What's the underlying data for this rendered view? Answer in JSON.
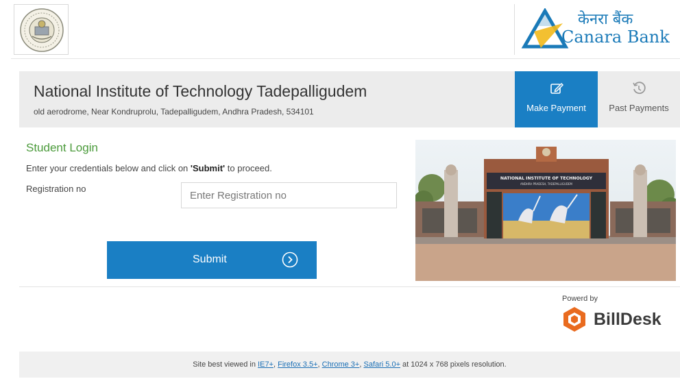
{
  "header": {
    "institute_logo_icon": "institute-seal-icon",
    "bank_name_hindi": "केनरा बैंक",
    "bank_name": "Canara Bank",
    "bank_colors": {
      "blue": "#1a7ab8",
      "yellow": "#f2b91b"
    }
  },
  "title_bar": {
    "institute_name": "National Institute of Technology Tadepalligudem",
    "address": "old aerodrome, Near Kondruprolu, Tadepalligudem, Andhra Pradesh, 534101",
    "tabs": [
      {
        "label": "Make Payment",
        "icon": "edit-icon",
        "active": true
      },
      {
        "label": "Past Payments",
        "icon": "history-icon",
        "active": false
      }
    ]
  },
  "login": {
    "title": "Student Login",
    "instruction_prefix": "Enter your credentials below and click on ",
    "instruction_bold": "'Submit'",
    "instruction_suffix": " to proceed.",
    "reg_label": "Registration no",
    "reg_placeholder": "Enter Registration no",
    "submit_label": "Submit",
    "submit_icon": "chevron-right-circle-icon"
  },
  "campus_image": {
    "gate_sign_title": "NATIONAL INSTITUTE OF TECHNOLOGY",
    "gate_sign_subtitle": "ANDHRA PRADESH, TADEPALLIGUDEM"
  },
  "powered_by": {
    "label": "Powerd by",
    "brand": "BillDesk",
    "brand_color": "#e96b1f"
  },
  "footer": {
    "prefix": "Site best viewed in ",
    "links": [
      "IE7+",
      "Firefox 3.5+",
      "Chrome 3+",
      "Safari 5.0+"
    ],
    "separator": ", ",
    "suffix": " at 1024 x 768 pixels resolution."
  },
  "colors": {
    "primary": "#1a7fc4",
    "login_title": "#4a9a3a",
    "title_bar_bg": "#ececec"
  }
}
